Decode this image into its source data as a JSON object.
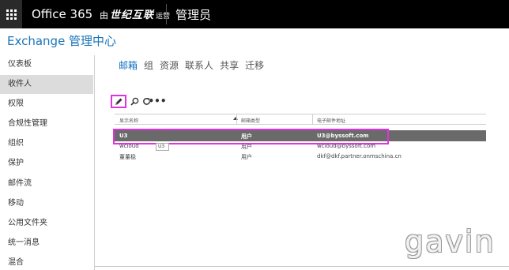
{
  "topbar": {
    "product": "Office 365",
    "by": "由",
    "partner_logo": "世纪互联",
    "operated": "运营",
    "role": "管理员"
  },
  "app_title": "Exchange 管理中心",
  "leftnav": {
    "items": [
      {
        "label": "仪表板",
        "active": false
      },
      {
        "label": "收件人",
        "active": true
      },
      {
        "label": "权限",
        "active": false
      },
      {
        "label": "合规性管理",
        "active": false
      },
      {
        "label": "组织",
        "active": false
      },
      {
        "label": "保护",
        "active": false
      },
      {
        "label": "邮件流",
        "active": false
      },
      {
        "label": "移动",
        "active": false
      },
      {
        "label": "公用文件夹",
        "active": false
      },
      {
        "label": "统一消息",
        "active": false
      },
      {
        "label": "混合",
        "active": false
      }
    ]
  },
  "tabs": [
    {
      "label": "邮箱",
      "active": true
    },
    {
      "label": "组",
      "active": false
    },
    {
      "label": "资源",
      "active": false
    },
    {
      "label": "联系人",
      "active": false
    },
    {
      "label": "共享",
      "active": false
    },
    {
      "label": "迁移",
      "active": false
    }
  ],
  "toolbar": {
    "icons": [
      "pencil-icon",
      "search-icon",
      "refresh-icon",
      "more-icon"
    ],
    "more_label": "•••"
  },
  "table": {
    "headers": {
      "display_name": "显示名称",
      "mailbox_type": "邮箱类型",
      "email": "电子邮件地址"
    },
    "rows": [
      {
        "display_name": "U3",
        "mailbox_type": "用户",
        "email": "U3@byssoft.com",
        "selected": true
      },
      {
        "display_name": "wcloud",
        "mailbox_type": "用户",
        "email": "wcloud@byssoft.com",
        "selected": false
      },
      {
        "display_name": "董董稳",
        "mailbox_type": "用户",
        "email": "dkf@dkf.partner.onmschina.cn",
        "selected": false
      }
    ],
    "tooltip": "U3"
  },
  "watermark": "gavin",
  "colors": {
    "topbar_bg": "#000000",
    "accent_blue": "#1a74b8",
    "highlight_magenta": "#e033e0",
    "selected_row": "#6a6a6a",
    "nav_active": "#dcdcdc"
  }
}
